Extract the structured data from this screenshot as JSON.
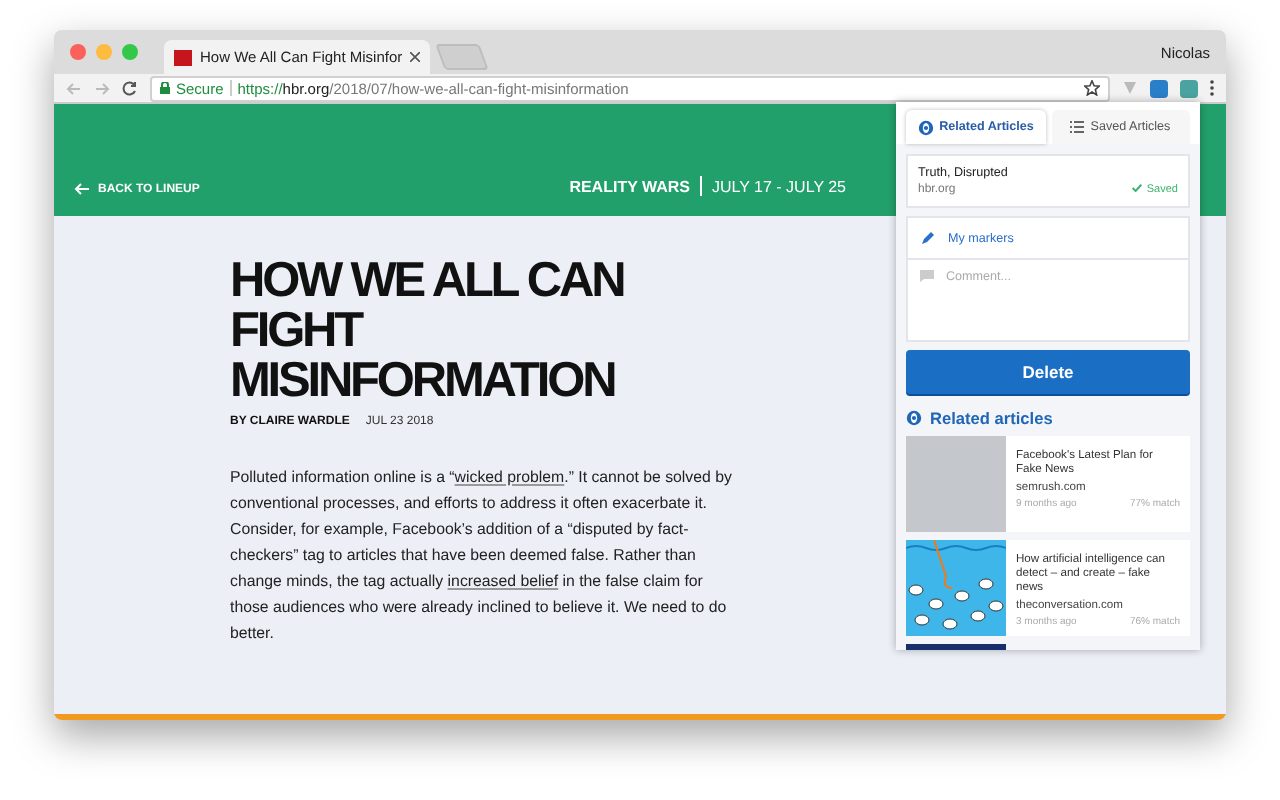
{
  "browser": {
    "tab_title": "How We All Can Fight Misinfor",
    "user": "Nicolas",
    "secure_label": "Secure",
    "url_scheme": "https://",
    "url_host": "hbr.org",
    "url_path": "/2018/07/how-we-all-can-fight-misinformation",
    "bookmarked": false
  },
  "header": {
    "back": "BACK TO LINEUP",
    "series": "REALITY WARS",
    "dates": "JULY 17 - JULY 25"
  },
  "article": {
    "title": "HOW WE ALL CAN FIGHT MISINFORMATION",
    "byline": "BY CLAIRE WARDLE",
    "date": "JUL 23 2018",
    "body": [
      {
        "kind": "text",
        "text": "Polluted information online is a “"
      },
      {
        "kind": "link",
        "text": "wicked problem"
      },
      {
        "kind": "text",
        "text": ".” It cannot be solved by conventional processes, and efforts to address it often exacerbate it. Consider, for example, Facebook’s addition of a “disputed by fact-checkers” tag to articles that have been deemed false. Rather than change minds, the tag actually "
      },
      {
        "kind": "link",
        "text": "increased belief"
      },
      {
        "kind": "text",
        "text": " in the false claim for those audiences who were already inclined to believe it. We need to do better."
      }
    ]
  },
  "popup": {
    "tabs": [
      {
        "label": "Related Articles",
        "selected": true
      },
      {
        "label": "Saved Articles",
        "selected": false
      }
    ],
    "saved": {
      "title": "Truth, Disrupted",
      "source": "hbr.org",
      "status": "Saved"
    },
    "markers": "My markers",
    "comment": {
      "placeholder": "Comment..."
    },
    "delete": "Delete",
    "related_heading": "Related articles",
    "related": [
      {
        "title": "Facebook's Latest Plan for Fake News",
        "source": "semrush.com",
        "age": "9 months ago",
        "match": "77% match",
        "kind": "plain"
      },
      {
        "title": "How artificial intelligence can detect – and create – fake news",
        "source": "theconversation.com",
        "age": "3 months ago",
        "match": "76% match",
        "kind": "illustration"
      }
    ],
    "more_thumb": true
  }
}
